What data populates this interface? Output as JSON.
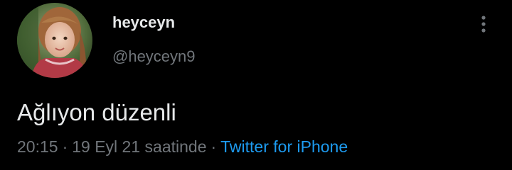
{
  "tweet": {
    "author": {
      "display_name": "heyceyn",
      "handle": "@heyceyn9",
      "avatar": "profile-photo-child"
    },
    "more_icon": "more-vertical-icon",
    "text": "Ağlıyon düzenli",
    "meta": {
      "time": "20:15",
      "separator": "·",
      "date": "19 Eyl 21 saatinde",
      "source": "Twitter for iPhone"
    }
  },
  "colors": {
    "background": "#000000",
    "text_primary": "#e7e9ea",
    "text_secondary": "#71767b",
    "link": "#1d9bf0"
  }
}
